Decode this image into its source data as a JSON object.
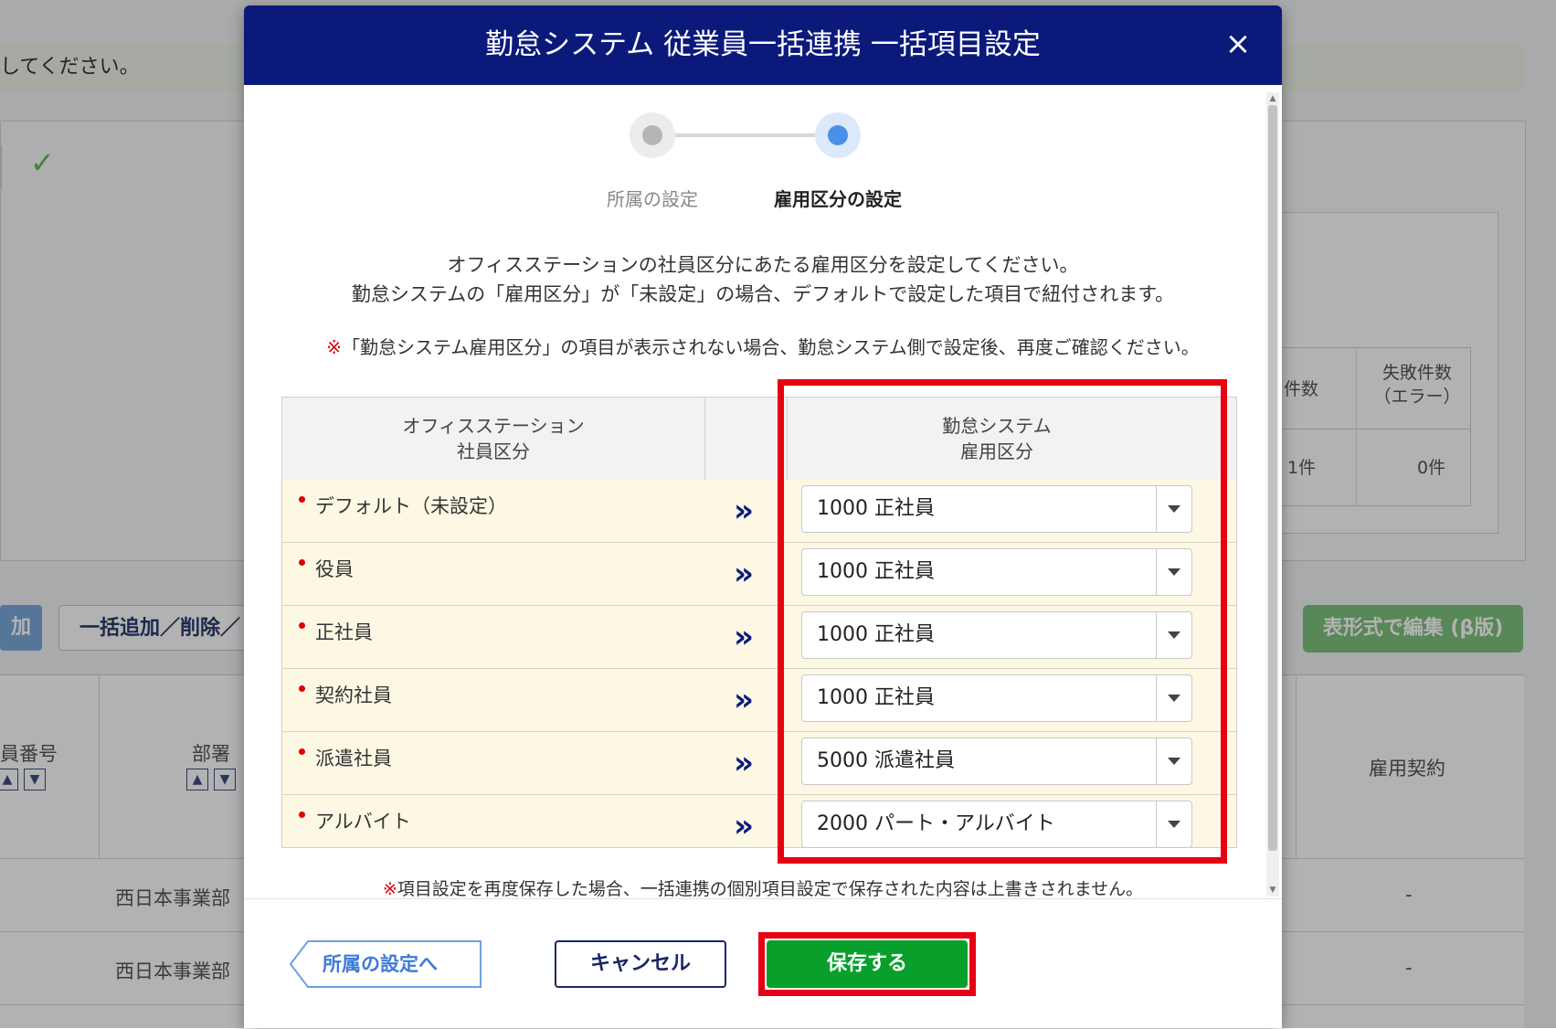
{
  "background": {
    "banner_text": "してください。",
    "check_mark": "✓",
    "mini_table": {
      "col_count": "件数",
      "col_fail": "失敗件数\n（エラー）",
      "count_value": "1件",
      "fail_value": "0件"
    },
    "btn_add": "加",
    "btn_bulk": "一括追加／削除／",
    "btn_table_edit": "表形式で編集 (β版)",
    "grid_header_number": "員番号",
    "grid_header_dept": "部署",
    "grid_header_contract": "雇用契約",
    "rows": [
      {
        "dept": "西日本事業部",
        "contract": "-"
      },
      {
        "dept": "西日本事業部",
        "contract": "-"
      }
    ]
  },
  "modal": {
    "title": "勤怠システム 従業員一括連携 一括項目設定",
    "close_label": "×",
    "steps": [
      {
        "label": "所属の設定",
        "state": "done"
      },
      {
        "label": "雇用区分の設定",
        "state": "active"
      }
    ],
    "description_line1": "オフィスステーションの社員区分にあたる雇用区分を設定してください。",
    "description_line2": "勤怠システムの「雇用区分」が「未設定」の場合、デフォルトで設定した項目で紐付されます。",
    "note_mark": "※",
    "note_top": "「勤怠システム雇用区分」の項目が表示されない場合、勤怠システム側で設定後、再度ご確認ください。",
    "table": {
      "header_left": "オフィスステーション\n社員区分",
      "header_right": "勤怠システム\n雇用区分",
      "rows": [
        {
          "label": "デフォルト（未設定）",
          "value": "1000 正社員"
        },
        {
          "label": "役員",
          "value": "1000 正社員"
        },
        {
          "label": "正社員",
          "value": "1000 正社員"
        },
        {
          "label": "契約社員",
          "value": "1000 正社員"
        },
        {
          "label": "派遣社員",
          "value": "5000 派遣社員"
        },
        {
          "label": "アルバイト",
          "value": "2000 パート・アルバイト"
        }
      ]
    },
    "note_bottom": "項目設定を再度保存した場合、一括連携の個別項目設定で保存された内容は上書きされません。",
    "footer": {
      "back_label": "所属の設定へ",
      "cancel_label": "キャンセル",
      "save_label": "保存する"
    }
  },
  "colors": {
    "header_navy": "#0b1a7a",
    "step_active": "#4a90e8",
    "step_done": "#bdbdbd",
    "row_bg": "#fdf8e4",
    "save_green": "#08a02a",
    "highlight_red": "#e60012"
  }
}
